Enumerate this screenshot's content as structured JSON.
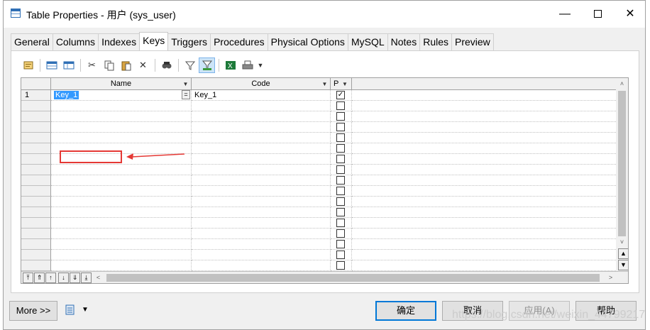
{
  "window": {
    "title": "Table Properties - 用户 (sys_user)",
    "minimize_glyph": "—",
    "close_glyph": "✕"
  },
  "tabs": [
    {
      "label": "General"
    },
    {
      "label": "Columns"
    },
    {
      "label": "Indexes"
    },
    {
      "label": "Keys",
      "active": true
    },
    {
      "label": "Triggers"
    },
    {
      "label": "Procedures"
    },
    {
      "label": "Physical Options"
    },
    {
      "label": "MySQL"
    },
    {
      "label": "Notes"
    },
    {
      "label": "Rules"
    },
    {
      "label": "Preview"
    }
  ],
  "toolbar": {
    "icons": [
      "properties-icon",
      "insert-row-icon",
      "add-row-icon",
      "cut-icon",
      "copy-icon",
      "paste-icon",
      "delete-icon",
      "find-icon",
      "filter-icon",
      "customize-columns-icon",
      "excel-export-icon",
      "print-icon",
      "print-dropdown-icon"
    ]
  },
  "grid": {
    "columns": {
      "name": "Name",
      "code": "Code",
      "primary": "P"
    },
    "rows": [
      {
        "num": "1",
        "name": "Key_1",
        "code": "Key_1",
        "primary": true,
        "selected": true
      }
    ],
    "equals_glyph": "=",
    "empty_rows": 16,
    "nav_buttons": [
      "⤒",
      "⇑",
      "↑",
      "↓",
      "⇓",
      "⤓"
    ],
    "scroll_left": "<",
    "scroll_right": ">",
    "scroll_up": "˄",
    "scroll_down": "˅"
  },
  "footer": {
    "more_label": "More >>",
    "ok_label": "确定",
    "cancel_label": "取消",
    "apply_label": "应用(A)",
    "help_label": "帮助"
  },
  "watermark": "https://blog.csdn.net/weixin_44799217",
  "colors": {
    "selection": "#3399ff",
    "annotation": "#e53935",
    "accent": "#0078d7"
  }
}
